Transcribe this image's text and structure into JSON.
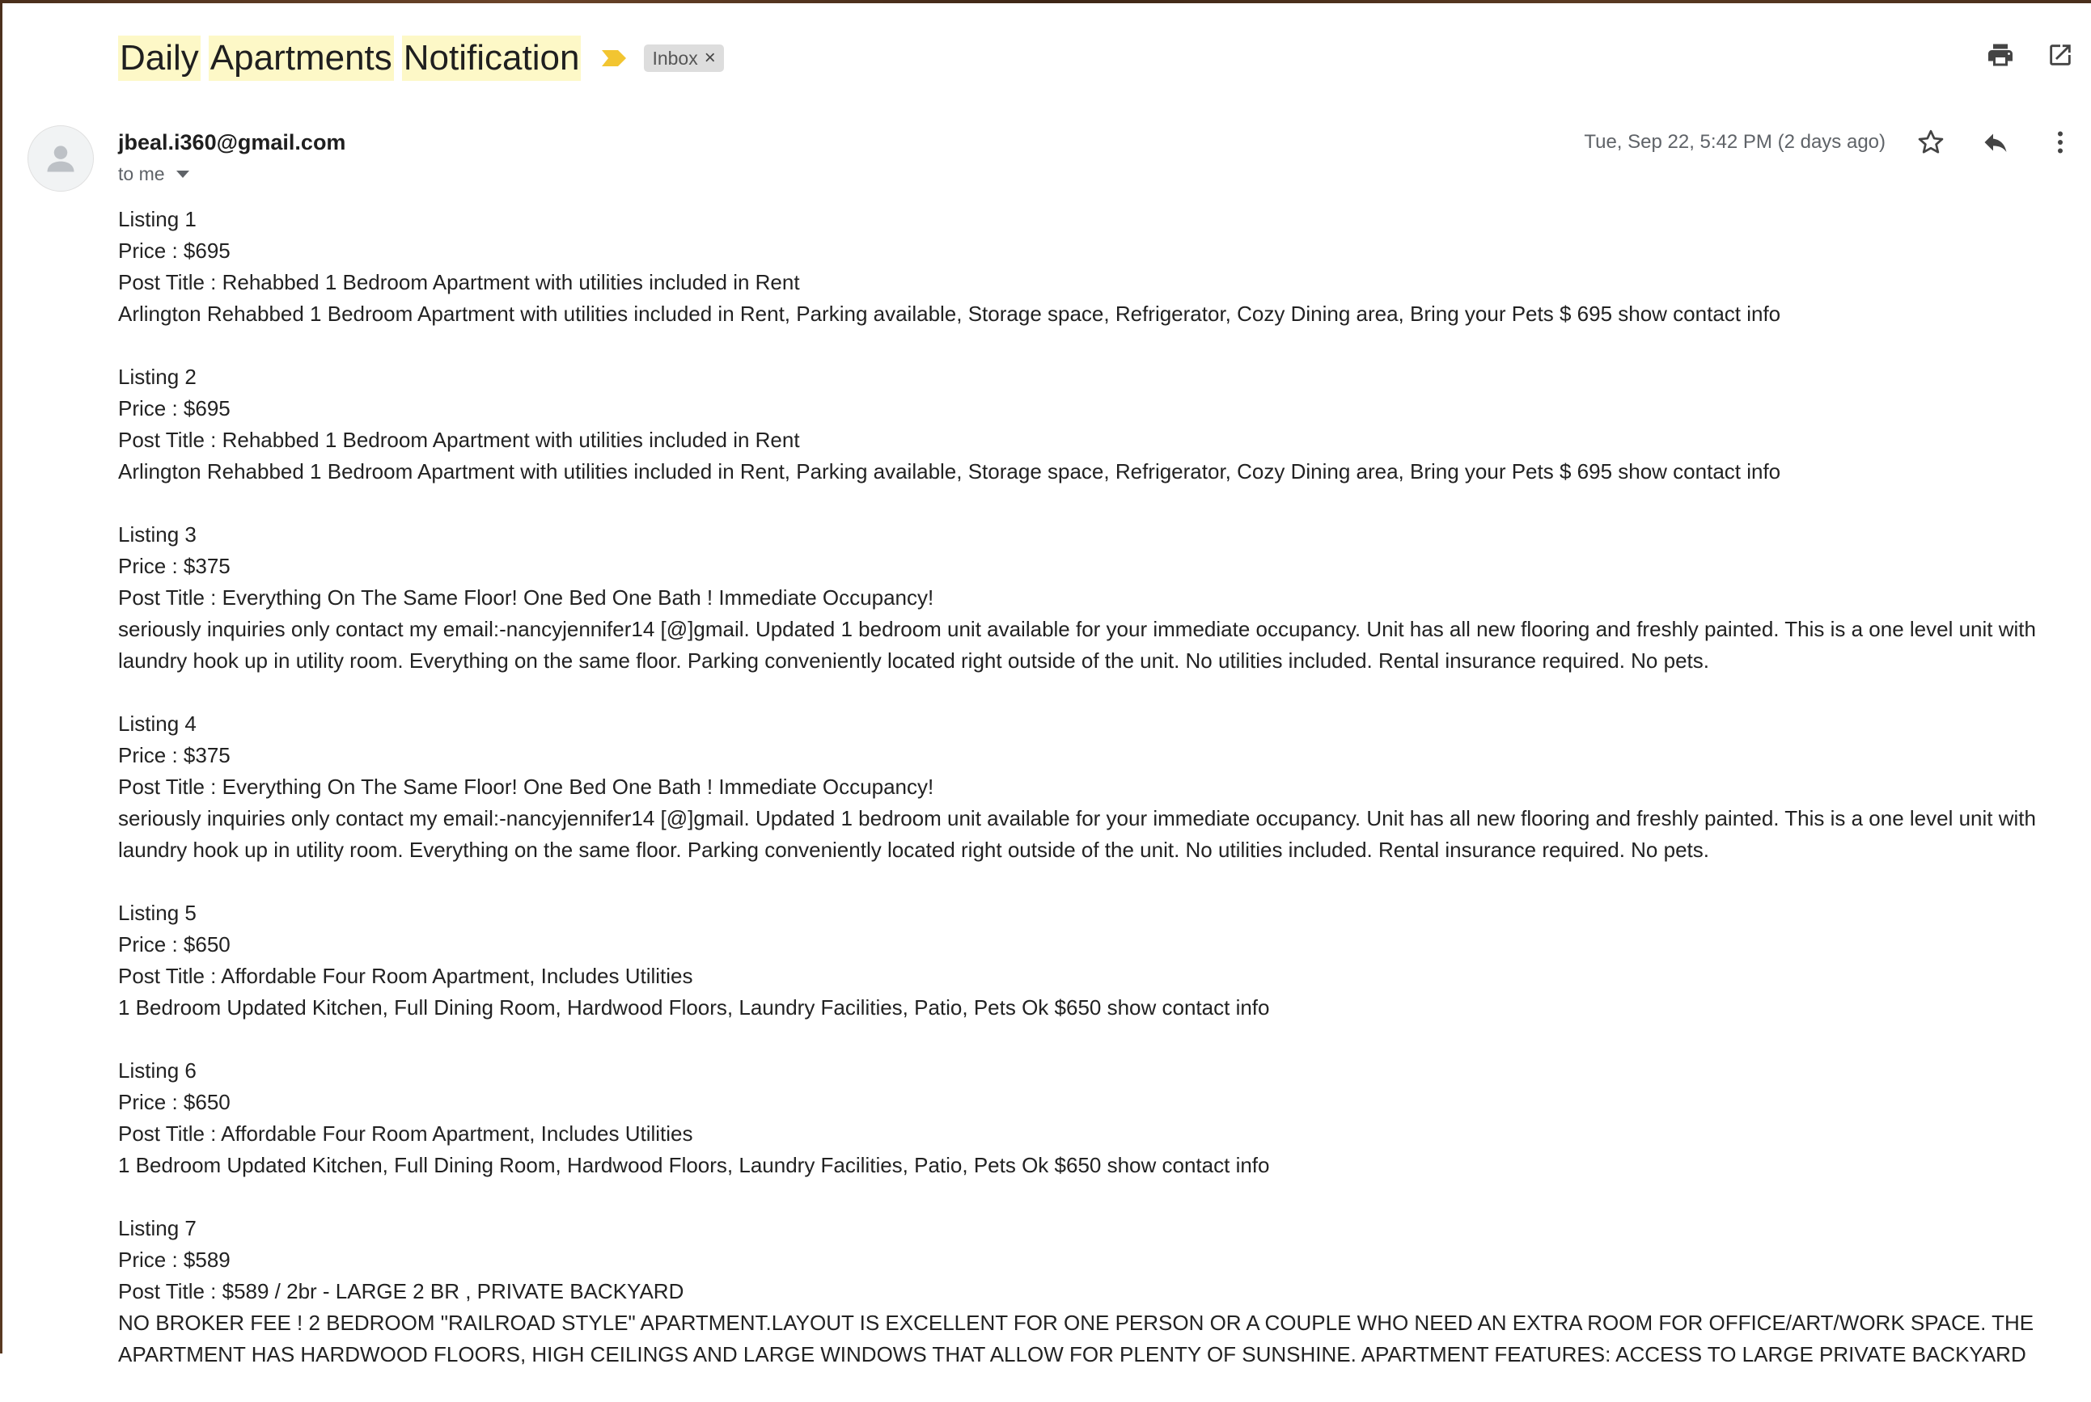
{
  "subject": {
    "words": [
      "Daily",
      "Apartments",
      "Notification"
    ]
  },
  "label_chip": {
    "text": "Inbox",
    "remove": "×"
  },
  "sender": {
    "email": "jbeal.i360@gmail.com",
    "to": "to me"
  },
  "date": "Tue, Sep 22, 5:42 PM (2 days ago)",
  "listings": [
    {
      "heading": "Listing 1",
      "price": "Price : $695",
      "title": "Post Title : Rehabbed 1 Bedroom Apartment with utilities included in Rent",
      "desc": "Arlington Rehabbed 1 Bedroom Apartment with utilities included in Rent, Parking available, Storage space, Refrigerator, Cozy Dining area, Bring your Pets $ 695 show contact info"
    },
    {
      "heading": "Listing 2",
      "price": "Price : $695",
      "title": "Post Title : Rehabbed 1 Bedroom Apartment with utilities included in Rent",
      "desc": "Arlington Rehabbed 1 Bedroom Apartment with utilities included in Rent, Parking available, Storage space, Refrigerator, Cozy Dining area, Bring your Pets $ 695 show contact info"
    },
    {
      "heading": "Listing 3",
      "price": "Price : $375",
      "title": "Post Title : Everything On The Same Floor! One Bed One Bath ! Immediate Occupancy!",
      "desc": "seriously inquiries only contact my email:-nancyjennifer14 [@]gmail. Updated 1 bedroom unit available for your immediate occupancy. Unit has all new flooring and freshly painted. This is a one level unit with laundry hook up in utility room. Everything on the same floor. Parking conveniently located right outside of the unit. No utilities included. Rental insurance required. No pets."
    },
    {
      "heading": "Listing 4",
      "price": "Price : $375",
      "title": "Post Title : Everything On The Same Floor! One Bed One Bath ! Immediate Occupancy!",
      "desc": "seriously inquiries only contact my email:-nancyjennifer14 [@]gmail. Updated 1 bedroom unit available for your immediate occupancy. Unit has all new flooring and freshly painted. This is a one level unit with laundry hook up in utility room. Everything on the same floor. Parking conveniently located right outside of the unit. No utilities included. Rental insurance required. No pets."
    },
    {
      "heading": "Listing 5",
      "price": "Price : $650",
      "title": "Post Title : Affordable Four Room Apartment, Includes Utilities",
      "desc": "1 Bedroom Updated Kitchen, Full Dining Room, Hardwood Floors, Laundry Facilities, Patio, Pets Ok $650 show contact info"
    },
    {
      "heading": "Listing 6",
      "price": "Price : $650",
      "title": "Post Title : Affordable Four Room Apartment, Includes Utilities",
      "desc": "1 Bedroom Updated Kitchen, Full Dining Room, Hardwood Floors, Laundry Facilities, Patio, Pets Ok $650 show contact info"
    },
    {
      "heading": "Listing 7",
      "price": "Price : $589",
      "title": "Post Title : $589 / 2br - LARGE 2 BR , PRIVATE BACKYARD",
      "desc": "NO BROKER FEE ! 2 BEDROOM \"RAILROAD STYLE\" APARTMENT.LAYOUT IS EXCELLENT FOR ONE PERSON OR A COUPLE WHO NEED AN EXTRA ROOM FOR OFFICE/ART/WORK SPACE. THE APARTMENT HAS HARDWOOD FLOORS, HIGH CEILINGS AND LARGE WINDOWS THAT ALLOW FOR PLENTY OF SUNSHINE. APARTMENT FEATURES: ACCESS TO LARGE PRIVATE BACKYARD"
    }
  ],
  "colors": {
    "highlight": "#fdf8c7",
    "important_marker": "#f2c531",
    "chip_bg": "#dddddd",
    "muted_text": "#5f6368"
  },
  "icons": [
    "important-marker-icon",
    "close-icon",
    "print-icon",
    "open-in-new-window-icon",
    "avatar-person-icon",
    "chevron-down-icon",
    "star-icon",
    "reply-icon",
    "more-vert-icon"
  ]
}
